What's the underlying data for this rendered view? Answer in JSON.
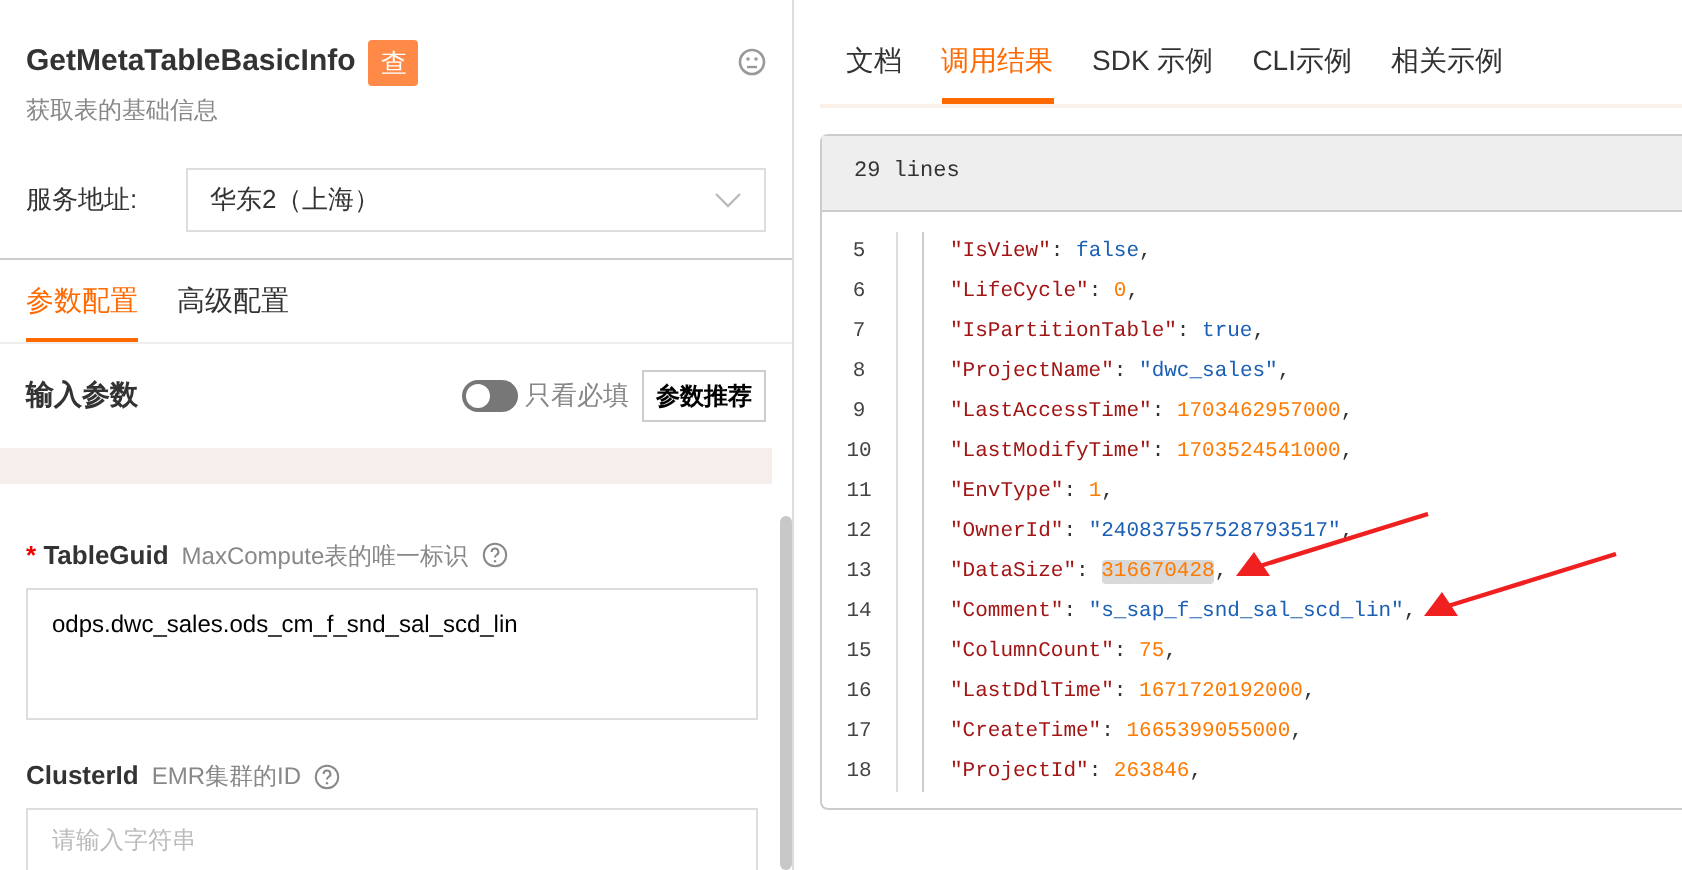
{
  "header": {
    "title": "GetMetaTableBasicInfo",
    "badge": "查",
    "subtitle": "获取表的基础信息"
  },
  "service": {
    "label": "服务地址:",
    "value": "华东2（上海）"
  },
  "config_tabs": [
    {
      "label": "参数配置",
      "selected": true
    },
    {
      "label": "高级配置",
      "selected": false
    }
  ],
  "input_params": {
    "title": "输入参数",
    "required_only_toggle": {
      "label": "只看必填",
      "on": false
    },
    "recommend_button": "参数推荐"
  },
  "required_marker": "*",
  "params": [
    {
      "kind": "textarea",
      "name": "TableGuid",
      "required": true,
      "description": "MaxCompute表的唯一标识",
      "value": "odps.dwc_sales.ods_cm_f_snd_sal_scd_lin"
    },
    {
      "kind": "input",
      "name": "ClusterId",
      "required": false,
      "description": "EMR集群的ID",
      "placeholder": "请输入字符串"
    }
  ],
  "result_tabs": [
    {
      "label": "文档",
      "selected": false
    },
    {
      "label": "调用结果",
      "selected": true
    },
    {
      "label": "SDK 示例",
      "selected": false
    },
    {
      "label": "CLI示例",
      "selected": false
    },
    {
      "label": "相关示例",
      "selected": false
    }
  ],
  "result": {
    "line_count": "29 lines",
    "separator": ": ",
    "line_end": ",",
    "lines": [
      {
        "number": "5",
        "key": "\"IsView\"",
        "kind": "boolean",
        "value": "false",
        "highlighted": false,
        "arrow": false
      },
      {
        "number": "6",
        "key": "\"LifeCycle\"",
        "kind": "number",
        "value": "0",
        "highlighted": false,
        "arrow": false
      },
      {
        "number": "7",
        "key": "\"IsPartitionTable\"",
        "kind": "boolean",
        "value": "true",
        "highlighted": false,
        "arrow": false
      },
      {
        "number": "8",
        "key": "\"ProjectName\"",
        "kind": "string",
        "value": "\"dwc_sales\"",
        "highlighted": false,
        "arrow": false
      },
      {
        "number": "9",
        "key": "\"LastAccessTime\"",
        "kind": "number",
        "value": "1703462957000",
        "highlighted": false,
        "arrow": false
      },
      {
        "number": "10",
        "key": "\"LastModifyTime\"",
        "kind": "number",
        "value": "1703524541000",
        "highlighted": false,
        "arrow": false
      },
      {
        "number": "11",
        "key": "\"EnvType\"",
        "kind": "number",
        "value": "1",
        "highlighted": false,
        "arrow": false
      },
      {
        "number": "12",
        "key": "\"OwnerId\"",
        "kind": "string",
        "value": "\"240837557528793517\"",
        "highlighted": false,
        "arrow": false
      },
      {
        "number": "13",
        "key": "\"DataSize\"",
        "kind": "number",
        "value": "316670428",
        "highlighted": true,
        "arrow": true
      },
      {
        "number": "14",
        "key": "\"Comment\"",
        "kind": "string",
        "value": "\"s_sap_f_snd_sal_scd_lin\"",
        "highlighted": false,
        "arrow": true
      },
      {
        "number": "15",
        "key": "\"ColumnCount\"",
        "kind": "number",
        "value": "75",
        "highlighted": false,
        "arrow": false
      },
      {
        "number": "16",
        "key": "\"LastDdlTime\"",
        "kind": "number",
        "value": "1671720192000",
        "highlighted": false,
        "arrow": false
      },
      {
        "number": "17",
        "key": "\"CreateTime\"",
        "kind": "number",
        "value": "1665399055000",
        "highlighted": false,
        "arrow": false
      },
      {
        "number": "18",
        "key": "\"ProjectId\"",
        "kind": "number",
        "value": "263846",
        "highlighted": false,
        "arrow": false
      }
    ]
  }
}
